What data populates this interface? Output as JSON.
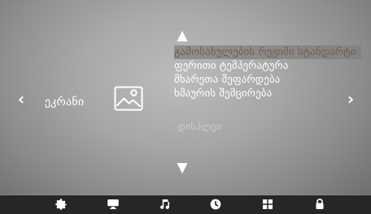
{
  "navigation": {
    "left_arrow": "‹",
    "right_arrow": "›",
    "up_arrow": "▲",
    "down_arrow": "▼"
  },
  "sidebar": {
    "category_label": "ეკრანი"
  },
  "menu": {
    "items": [
      {
        "label": "გამოსახულების რეჟიმი სტანდარტი"
      },
      {
        "label": "ფერითი ტემპერატურა"
      },
      {
        "label": "მხარეთა შეფარდება"
      },
      {
        "label": "ხმაურის შემცირება"
      },
      {
        "label": "დისპლეი"
      }
    ]
  },
  "bottom_bar": {
    "icons": [
      {
        "name": "gear-icon"
      },
      {
        "name": "monitor-icon"
      },
      {
        "name": "music-note-icon"
      },
      {
        "name": "clock-icon"
      },
      {
        "name": "grid-icon"
      },
      {
        "name": "lock-icon"
      }
    ]
  }
}
